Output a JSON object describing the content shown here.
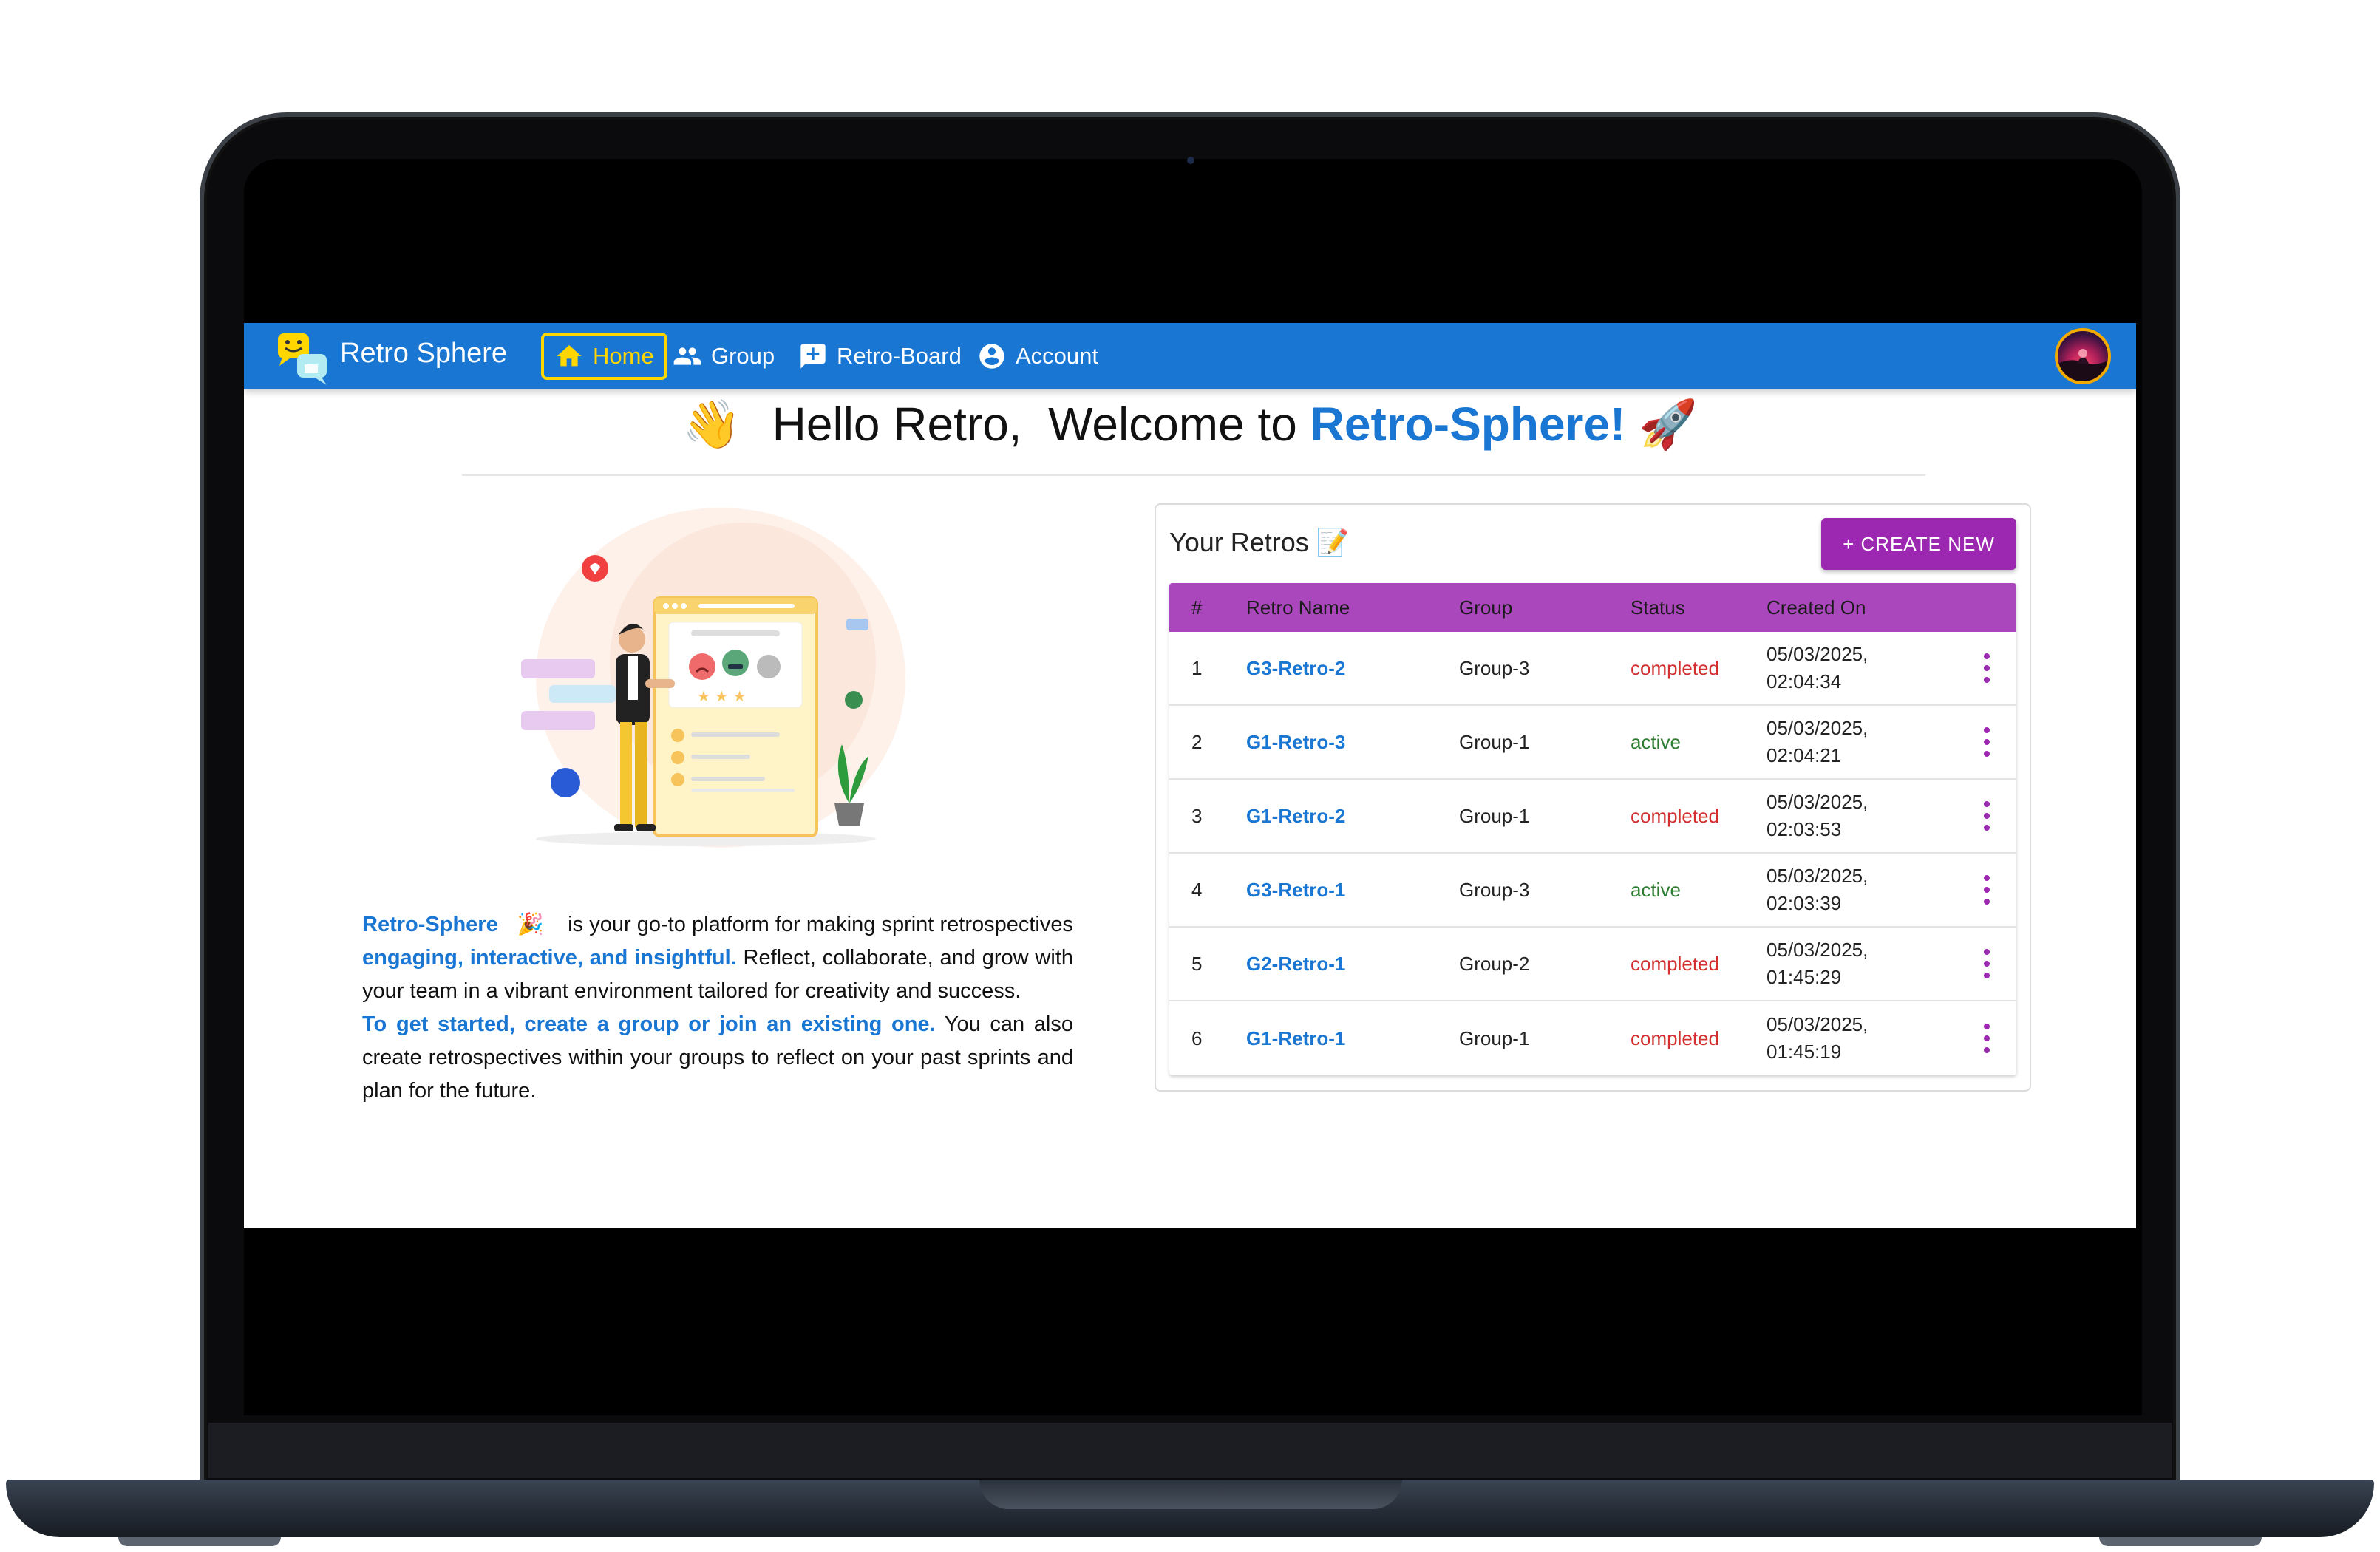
{
  "app": {
    "brand": "Retro Sphere"
  },
  "nav": {
    "items": [
      {
        "label": "Home",
        "icon": "home-icon",
        "active": true
      },
      {
        "label": "Group",
        "icon": "group-icon"
      },
      {
        "label": "Retro-Board",
        "icon": "retro-board-icon"
      },
      {
        "label": "Account",
        "icon": "account-circle-icon"
      }
    ]
  },
  "greeting": {
    "wave": "👋",
    "prefix": "Hello Retro,  Welcome to ",
    "highlight": "Retro-Sphere!",
    "rocket": "🚀"
  },
  "intro": {
    "brand": "Retro-Sphere",
    "party": "🎉",
    "p1a": " is your go-to platform for making sprint retrospectives ",
    "p1b": "engaging, interactive, and insightful.",
    "p1c": " Reflect, collaborate, and grow with your team in a vibrant environment tailored for creativity and success.",
    "p2a": "To get started, create a group or join an existing one.",
    "p2b": " You can also create retrospectives within your groups to reflect on your past sprints and plan for the future."
  },
  "retros": {
    "title": "Your Retros 📝",
    "create_label": "+ CREATE NEW",
    "columns": [
      "#",
      "Retro Name",
      "Group",
      "Status",
      "Created On"
    ],
    "rows": [
      {
        "num": "1",
        "name": "G3-Retro-2",
        "group": "Group-3",
        "status": "completed",
        "date": "05/03/2025,",
        "time": "02:04:34"
      },
      {
        "num": "2",
        "name": "G1-Retro-3",
        "group": "Group-1",
        "status": "active",
        "date": "05/03/2025,",
        "time": "02:04:21"
      },
      {
        "num": "3",
        "name": "G1-Retro-2",
        "group": "Group-1",
        "status": "completed",
        "date": "05/03/2025,",
        "time": "02:03:53"
      },
      {
        "num": "4",
        "name": "G3-Retro-1",
        "group": "Group-3",
        "status": "active",
        "date": "05/03/2025,",
        "time": "02:03:39"
      },
      {
        "num": "5",
        "name": "G2-Retro-1",
        "group": "Group-2",
        "status": "completed",
        "date": "05/03/2025,",
        "time": "01:45:29"
      },
      {
        "num": "6",
        "name": "G1-Retro-1",
        "group": "Group-1",
        "status": "completed",
        "date": "05/03/2025,",
        "time": "01:45:19"
      }
    ]
  },
  "colors": {
    "primary": "#1976d2",
    "accent": "#9c27b0",
    "table_header": "#ab47bc",
    "nav_active": "#ffd600",
    "status_completed": "#d32f2f",
    "status_active": "#2e7d32"
  }
}
